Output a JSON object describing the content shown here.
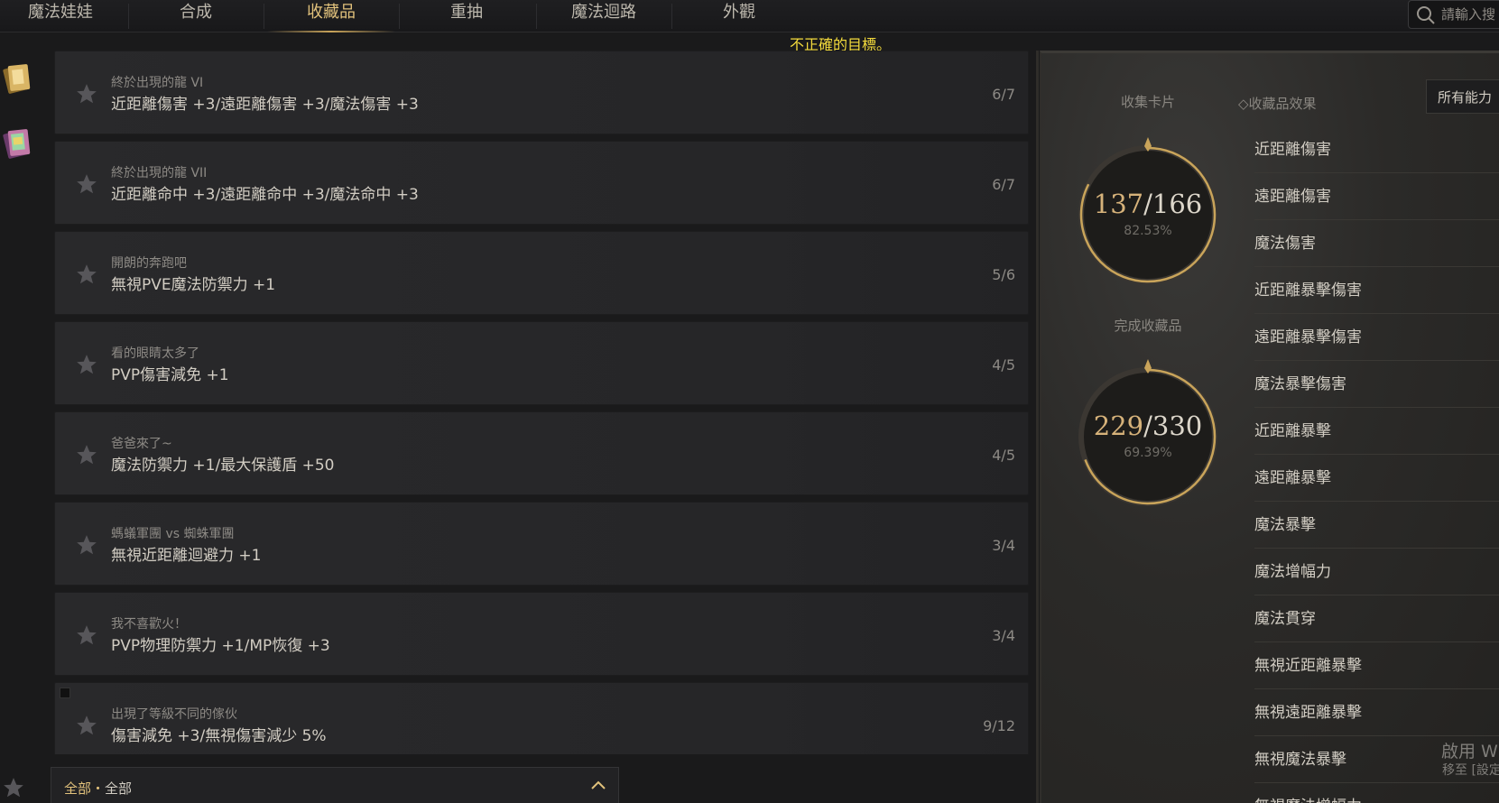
{
  "nav": {
    "tabs": [
      {
        "label": "魔法娃娃"
      },
      {
        "label": "合成"
      },
      {
        "label": "收藏品"
      },
      {
        "label": "重抽"
      },
      {
        "label": "魔法迴路"
      },
      {
        "label": "外觀"
      }
    ],
    "active_tab": "收藏品",
    "search_placeholder": "請輸入搜"
  },
  "error_message": "不正確的目標。",
  "collections": [
    {
      "title": "終於出現的龍 VI",
      "effect": "近距離傷害 +3/遠距離傷害 +3/魔法傷害 +3",
      "count": "6/7"
    },
    {
      "title": "終於出現的龍 VII",
      "effect": "近距離命中 +3/遠距離命中 +3/魔法命中 +3",
      "count": "6/7"
    },
    {
      "title": "開朗的奔跑吧",
      "effect": "無視PVE魔法防禦力 +1",
      "count": "5/6"
    },
    {
      "title": "看的眼睛太多了",
      "effect": "PVP傷害減免 +1",
      "count": "4/5"
    },
    {
      "title": "爸爸來了~",
      "effect": "魔法防禦力 +1/最大保護盾 +50",
      "count": "4/5"
    },
    {
      "title": "螞蟻軍團 vs 蜘蛛軍團",
      "effect": "無視近距離迴避力 +1",
      "count": "3/4"
    },
    {
      "title": "我不喜歡火！",
      "effect": "PVP物理防禦力 +1/MP恢復 +3",
      "count": "3/4"
    },
    {
      "title": "出現了等級不同的傢伙",
      "effect": "傷害減免 +3/無視傷害減少 5%",
      "count": "9/12"
    }
  ],
  "filter": {
    "first": "全部",
    "separator": "・",
    "second": "全部"
  },
  "stats": {
    "cards": {
      "label": "收集卡片",
      "got": "137",
      "total": "/166",
      "pct": "82.53%",
      "ratio": 0.8253
    },
    "completed": {
      "label": "完成收藏品",
      "got": "229",
      "total": "/330",
      "pct": "69.39%",
      "ratio": 0.6939
    }
  },
  "effects_tab_label": "收藏品效果",
  "all_abilities_label": "所有能力",
  "effect_stats": [
    "近距離傷害",
    "遠距離傷害",
    "魔法傷害",
    "近距離暴擊傷害",
    "遠距離暴擊傷害",
    "魔法暴擊傷害",
    "近距離暴擊",
    "遠距離暴擊",
    "魔法暴擊",
    "魔法增幅力",
    "魔法貫穿",
    "無視近距離暴擊",
    "無視遠距離暴擊",
    "無視魔法暴擊",
    "無視魔法增幅力"
  ],
  "windows_watermark": {
    "line1": "啟用 W",
    "line2": "移至 [設定"
  },
  "colors": {
    "accent_gold": "#e2c27c",
    "error_yellow": "#f5dc3c"
  }
}
